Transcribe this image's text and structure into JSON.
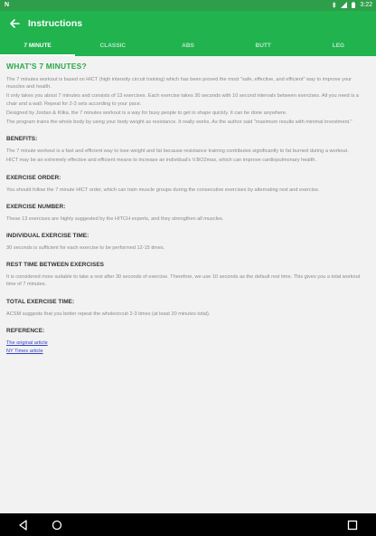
{
  "status_bar": {
    "notification_letter": "N",
    "time": "3:22"
  },
  "app_bar": {
    "title": "Instructions"
  },
  "tabs": [
    {
      "label": "7 MINUTE",
      "active": true
    },
    {
      "label": "CLASSIC",
      "active": false
    },
    {
      "label": "ABS",
      "active": false
    },
    {
      "label": "BUTT",
      "active": false
    },
    {
      "label": "LEG",
      "active": false
    }
  ],
  "content": {
    "heading": "WHAT'S 7 MINUTES?",
    "intro": [
      "The 7 minutes workout is based on HICT (high intensity circuit training) which has been proved the most \"safe, effective, and efficient\" way to improve your muscles and health.",
      "It only takes you about 7 minutes and consists of 13 exercises. Each exercise takes 30 seconds with 10 second intervals between exercises. All you need is a chair and a wall. Repeat for 2-3 sets according to your pace.",
      "Designed by Jordan & Klika, the 7 minutes workout is a way for busy people to get in shape quickly. It can be done anywhere.",
      "The program trains the whole body by using your body weight as resistance. It really works. As the author said \"maximum results with minimal investment.\""
    ],
    "sections": [
      {
        "title": "BENEFITS:",
        "paragraphs": [
          "The 7 minute workout is a fast and efficient way to lose weight and fat because resistance training contributes significantly to fat burned during a workout.",
          "HICT may be an extremely effective and efficient means to increase an individual's V.BO2max, which can improve cardiopulmonary health."
        ]
      },
      {
        "title": "EXERCISE ORDER:",
        "paragraphs": [
          "You should follow the 7 minute HICT order, which can train muscle groups during the consecutive exercises by alternating rest and exercise."
        ]
      },
      {
        "title": "EXERCISE NUMBER:",
        "paragraphs": [
          "These 13 exercises are highly suggested by the HITCH experts, and they strengthen all muscles."
        ]
      },
      {
        "title": "INDIVIDUAL EXERCISE TIME:",
        "paragraphs": [
          "30 seconds is sufficient for each exercise to be performed 12-15 times."
        ]
      },
      {
        "title": "REST TIME BETWEEN EXERCISES",
        "paragraphs": [
          "It is considered more suitable to take a rest after 30 seconds of exercise. Therefore, we use 10 seconds as the default rest time. This gives you a total workout time of 7 minutes."
        ]
      },
      {
        "title": "TOTAL EXERCISE TIME:",
        "paragraphs": [
          "ACSM suggests that you better repeat the wholecircuit 2-3 times (at least 20 minutes total)."
        ]
      }
    ],
    "reference": {
      "title": "REFERENCE:",
      "links": [
        "The original article",
        "NY Times article"
      ]
    }
  },
  "colors": {
    "status_bar": "#2f9e4a",
    "app_bar": "#20b34e",
    "heading": "#2aa84a",
    "link": "#3344cc"
  },
  "icons": {
    "back": "arrow-back-icon",
    "nav_back": "triangle-back-icon",
    "nav_home": "circle-home-icon",
    "nav_recents": "square-recents-icon"
  }
}
